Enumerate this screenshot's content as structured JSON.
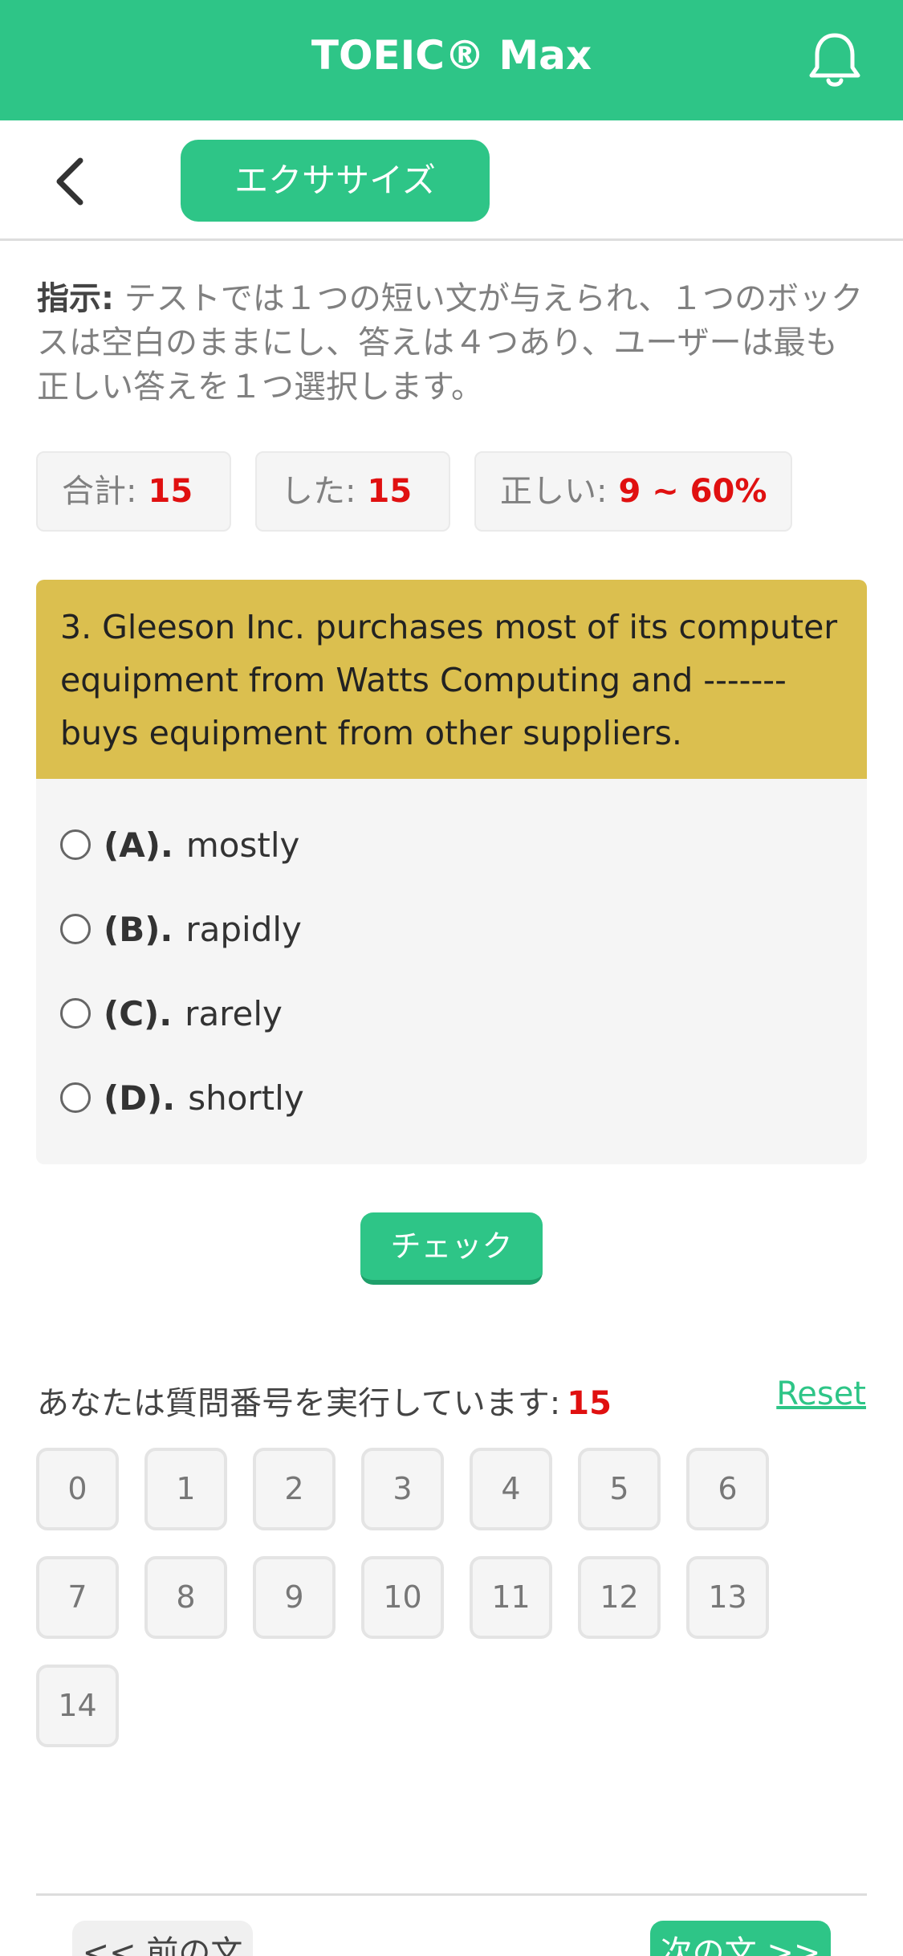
{
  "app": {
    "title": "TOEIC® Max"
  },
  "nav": {
    "tab_label": "エクササイズ"
  },
  "instructions": {
    "label": "指示:",
    "text": " テストでは１つの短い文が与えられ、１つのボックスは空白のままにし、答えは４つあり、ユーザーは最も正しい答えを１つ選択します。"
  },
  "stats": {
    "total_label": "合計:",
    "total_value": "15",
    "done_label": "した:",
    "done_value": "15",
    "correct_label": "正しい:",
    "correct_value": "9 ~ 60%"
  },
  "question": {
    "text": "3. Gleeson Inc. purchases most of its computer equipment from Watts Computing and ------- buys equipment from other suppliers.",
    "options": [
      {
        "letter": "(A).",
        "text": "mostly"
      },
      {
        "letter": "(B).",
        "text": "rapidly"
      },
      {
        "letter": "(C).",
        "text": "rarely"
      },
      {
        "letter": "(D).",
        "text": "shortly"
      }
    ]
  },
  "check_label": "チェック",
  "progress": {
    "label": "あなたは質問番号を実行しています:",
    "current": "15",
    "reset_label": "Reset",
    "numbers": [
      "0",
      "1",
      "2",
      "3",
      "4",
      "5",
      "6",
      "7",
      "8",
      "9",
      "10",
      "11",
      "12",
      "13",
      "14"
    ]
  },
  "footer": {
    "prev_label": "<< 前の文",
    "next_label": "次の文 >>"
  },
  "colors": {
    "brand": "#2ec587",
    "question_header": "#dbbf4f",
    "highlight_number": "#e01010"
  },
  "icons": {
    "bell": "bell-icon",
    "back": "chevron-left-icon"
  }
}
